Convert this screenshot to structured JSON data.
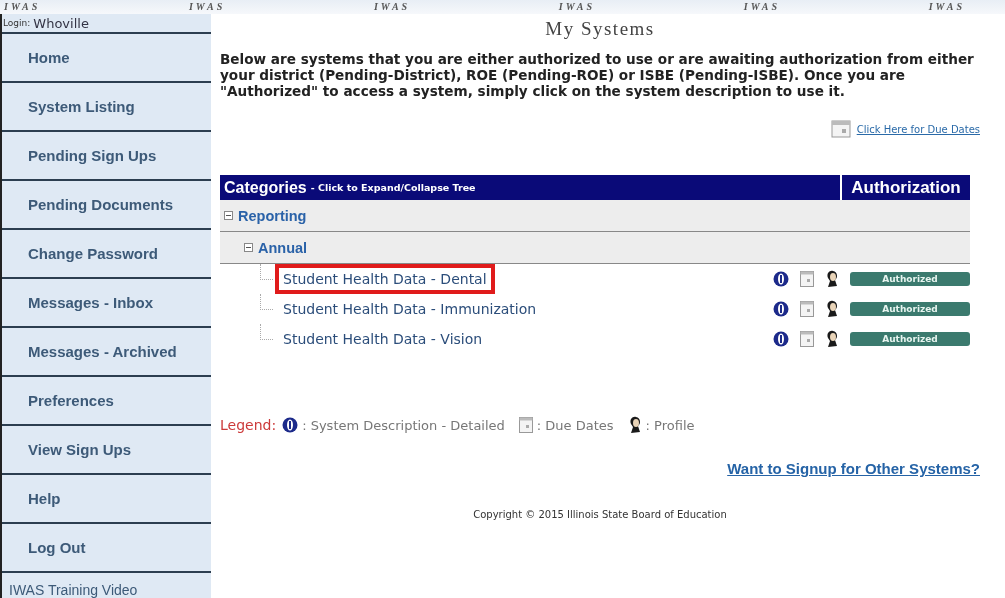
{
  "banner": [
    "IWAS",
    "IWAS",
    "IWAS",
    "IWAS",
    "IWAS",
    "IWAS"
  ],
  "login": {
    "label": "Login:",
    "user": "Whoville"
  },
  "sidebar": {
    "items": [
      {
        "label": "Home"
      },
      {
        "label": "System Listing"
      },
      {
        "label": "Pending Sign Ups"
      },
      {
        "label": "Pending Documents"
      },
      {
        "label": "Change Password"
      },
      {
        "label": "Messages - Inbox"
      },
      {
        "label": "Messages - Archived"
      },
      {
        "label": "Preferences"
      },
      {
        "label": "View Sign Ups"
      },
      {
        "label": "Help"
      },
      {
        "label": "Log Out"
      },
      {
        "label": "IWAS Training Video",
        "kind": "plain"
      }
    ]
  },
  "title": "My Systems",
  "intro": "Below are systems that you are either authorized to use or are awaiting authorization from either your district (Pending-District), ROE (Pending-ROE) or ISBE (Pending-ISBE). Once you are \"Authorized\" to access a system, simply click on the system description to use it.",
  "due_dates_link": "Click Here for Due Dates",
  "table": {
    "header": "Categories",
    "header_hint": "- Click to Expand/Collapse Tree",
    "authorization_header": "Authorization",
    "tree": [
      {
        "label": "Reporting",
        "expanded": true,
        "children": [
          {
            "label": "Annual",
            "expanded": true,
            "children": [
              {
                "label": "Student Health Data - Dental",
                "status": "Authorized",
                "highlighted": true
              },
              {
                "label": "Student Health Data - Immunization",
                "status": "Authorized",
                "highlighted": false
              },
              {
                "label": "Student Health Data - Vision",
                "status": "Authorized",
                "highlighted": false
              }
            ]
          }
        ]
      }
    ]
  },
  "legend": {
    "label": "Legend:",
    "items": [
      {
        "kind": "info",
        "text": ": System Description - Detailed"
      },
      {
        "kind": "calendar",
        "text": ": Due Dates"
      },
      {
        "kind": "profile",
        "text": ": Profile"
      }
    ]
  },
  "signup_link": "Want to Signup for Other Systems?",
  "copyright": "Copyright © 2015 Illinois State Board of Education"
}
